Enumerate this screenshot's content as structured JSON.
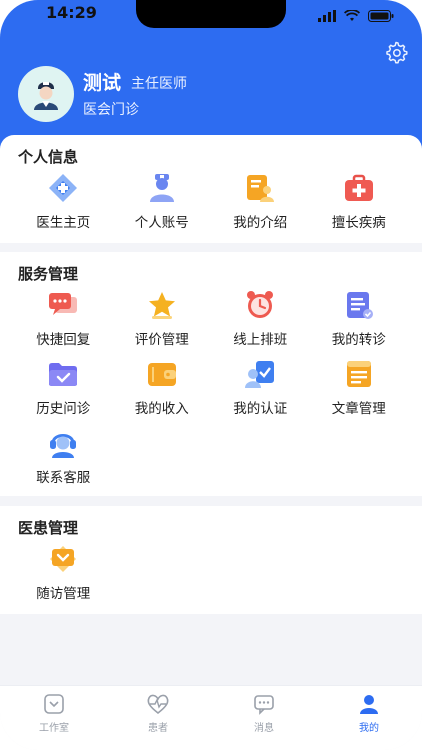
{
  "status": {
    "time": "14:29"
  },
  "header": {
    "name": "测试",
    "title": "主任医师",
    "department": "医会门诊"
  },
  "sections": [
    {
      "title": "个人信息",
      "items": [
        {
          "label": "医生主页",
          "icon": "doctor-home-icon"
        },
        {
          "label": "个人账号",
          "icon": "account-icon"
        },
        {
          "label": "我的介绍",
          "icon": "introduction-icon"
        },
        {
          "label": "擅长疾病",
          "icon": "medical-kit-icon"
        }
      ]
    },
    {
      "title": "服务管理",
      "items": [
        {
          "label": "快捷回复",
          "icon": "quick-reply-icon"
        },
        {
          "label": "评价管理",
          "icon": "star-icon"
        },
        {
          "label": "线上排班",
          "icon": "alarm-clock-icon"
        },
        {
          "label": "我的转诊",
          "icon": "referral-icon"
        },
        {
          "label": "历史问诊",
          "icon": "folder-icon"
        },
        {
          "label": "我的收入",
          "icon": "wallet-icon"
        },
        {
          "label": "我的认证",
          "icon": "certification-icon"
        },
        {
          "label": "文章管理",
          "icon": "article-icon"
        },
        {
          "label": "联系客服",
          "icon": "customer-service-icon"
        }
      ]
    },
    {
      "title": "医患管理",
      "items": [
        {
          "label": "随访管理",
          "icon": "follow-up-icon"
        }
      ]
    }
  ],
  "tabbar": [
    {
      "label": "工作室",
      "icon": "studio-icon",
      "active": false
    },
    {
      "label": "患者",
      "icon": "heartbeat-icon",
      "active": false
    },
    {
      "label": "消息",
      "icon": "message-icon",
      "active": false
    },
    {
      "label": "我的",
      "icon": "profile-icon",
      "active": true
    }
  ],
  "colors": {
    "primary": "#2d6cf1",
    "background": "#f3f4f8"
  }
}
